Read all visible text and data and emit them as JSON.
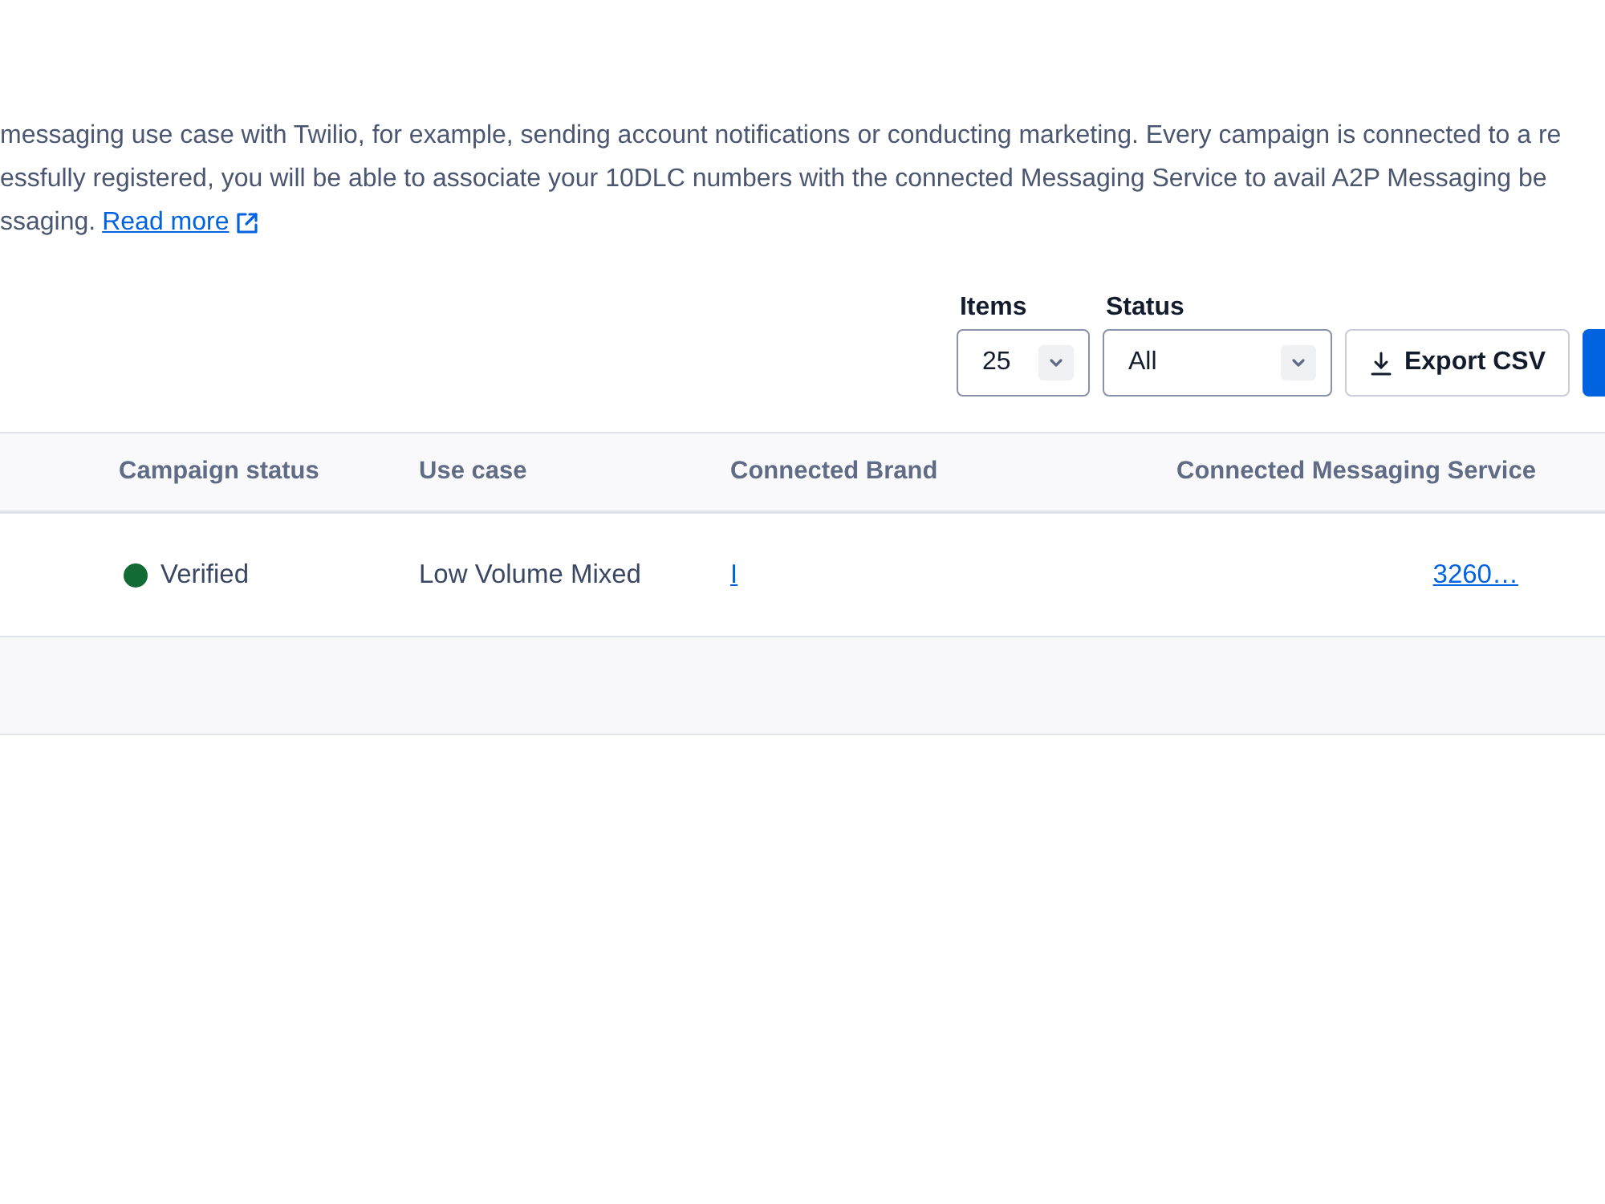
{
  "description": {
    "lines": [
      "messaging use case with Twilio, for example, sending account notifications or conducting marketing. Every campaign is connected to a re",
      "essfully registered, you will be able to associate your 10DLC numbers with the connected Messaging Service to avail A2P Messaging be"
    ],
    "last_line": "ssaging.",
    "link": "Read more"
  },
  "filters": [
    {
      "label": "Items",
      "value": "25",
      "kind": "narrow"
    },
    {
      "label": "Status",
      "value": "All",
      "kind": "wide"
    }
  ],
  "buttons": [
    {
      "kind": "secondary",
      "label": "Export CSV"
    },
    {
      "kind": "primary"
    }
  ],
  "table": {
    "columns": [
      "Campaign status",
      "Use case",
      "Connected Brand",
      "Connected Messaging Service"
    ],
    "rows": [
      {
        "status": {
          "label": "Verified",
          "color": "#126b35"
        },
        "use_case": "Low Volume Mixed",
        "brand": "I",
        "messaging_service": "3260…"
      }
    ]
  }
}
